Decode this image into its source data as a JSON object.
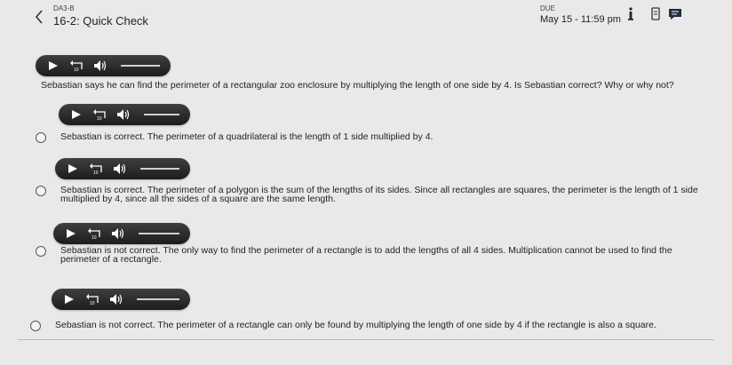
{
  "header": {
    "class_code": "DA3-B",
    "title": "16-2: Quick Check",
    "due_label": "DUE",
    "due_date": "May 15 - 11:59 pm"
  },
  "icons": {
    "back": "chevron-left-icon",
    "info": "info-icon",
    "document": "document-icon",
    "chat": "chat-icon",
    "play": "play-icon",
    "replay": "replay-10-icon",
    "volume": "volume-icon"
  },
  "question": {
    "text": "Sebastian says he can find the perimeter of a rectangular zoo enclosure by multiplying the length of one side by 4. Is Sebastian correct? Why or why not?"
  },
  "choices": [
    {
      "text": "Sebastian is correct. The perimeter of a quadrilateral is the length of 1 side multiplied by 4."
    },
    {
      "text": "Sebastian is correct. The perimeter of a polygon is the sum of the lengths of its sides. Since all rectangles are squares, the perimeter is the length of 1 side multiplied by 4, since all the sides of a square are the same length."
    },
    {
      "text": "Sebastian is not correct. The only way to find the perimeter of a rectangle is to add the lengths of all 4 sides. Multiplication cannot be used to find the perimeter of a rectangle."
    },
    {
      "text": "Sebastian is not correct. The perimeter of a rectangle can only be found by multiplying the length of one side by 4 if the rectangle is also a square."
    }
  ]
}
